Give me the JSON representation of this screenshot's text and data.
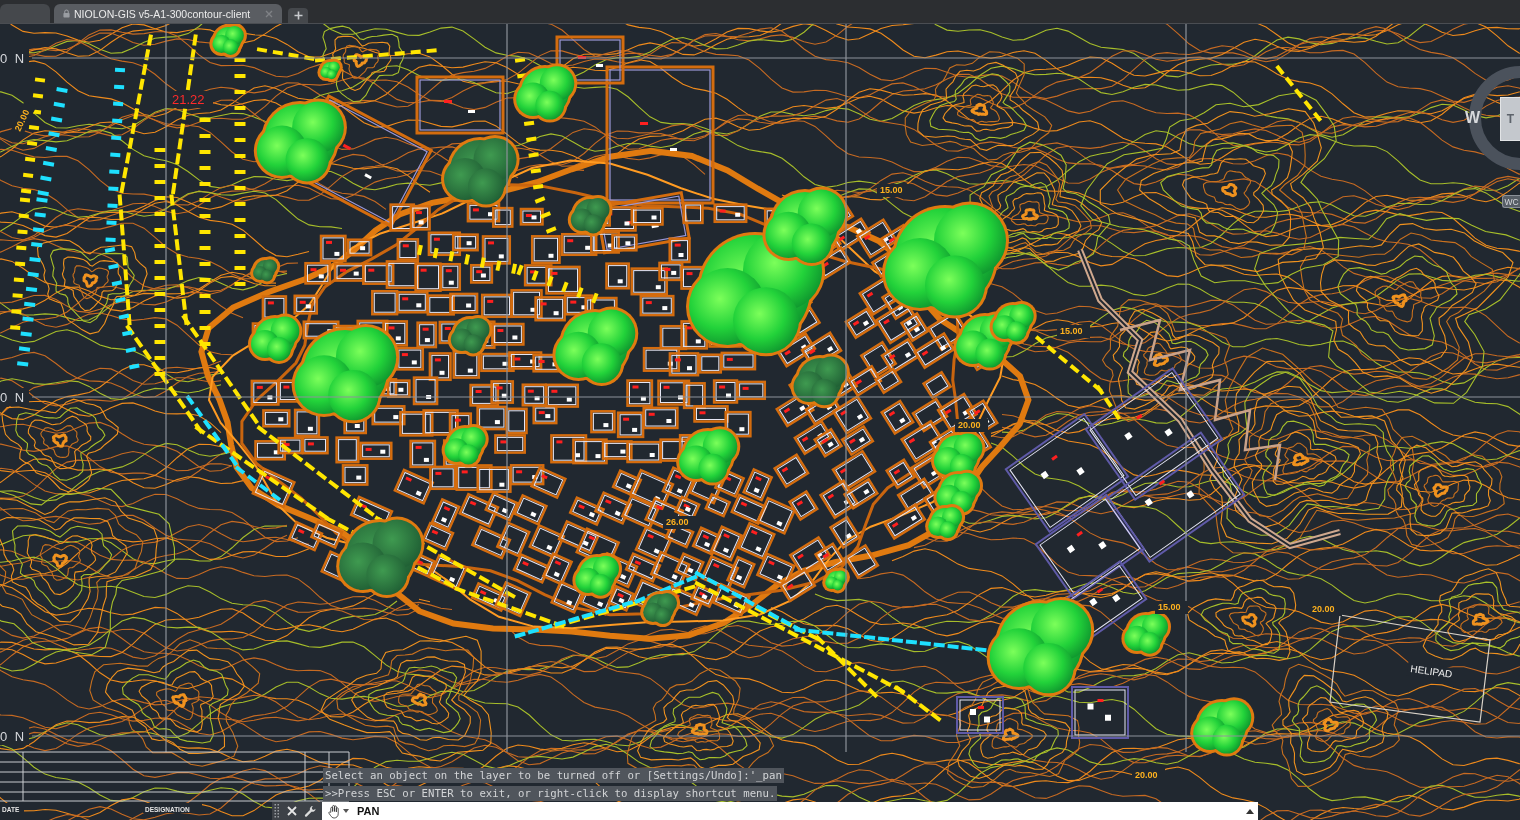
{
  "tabs": [
    {
      "kind": "start",
      "selected": false
    },
    {
      "kind": "drawing",
      "label": "NIOLON-GIS v5-A1-300contour-client",
      "locked": true,
      "selected": true
    }
  ],
  "drawing": {
    "grid_labels": [
      "0 N",
      "0 N",
      "0 N"
    ],
    "labels": [
      {
        "text": "21.22",
        "kind": "spot_height"
      },
      {
        "text": "HELIPAD",
        "kind": "area_name"
      },
      {
        "text": "20.00",
        "kind": "contour_height"
      },
      {
        "text": "26.00",
        "kind": "contour_height"
      },
      {
        "text": "15.00",
        "kind": "contour_height"
      },
      {
        "text": "20.00",
        "kind": "contour_height"
      },
      {
        "text": "20.00",
        "kind": "contour_height"
      },
      {
        "text": "15.00",
        "kind": "contour_height"
      },
      {
        "text": "15.00",
        "kind": "contour_height"
      },
      {
        "text": "20.00",
        "kind": "contour_height"
      }
    ],
    "title_block": {
      "headings": [
        "DATE",
        "DESIGNATION"
      ]
    }
  },
  "viewcube": {
    "compass": "W",
    "face": "T",
    "ucs": "WC"
  },
  "command_line": {
    "history": [
      "Select an object on the layer to be turned off or [Settings/Undo]:'_pan",
      ">>Press ESC or ENTER to exit, or right-click to display shortcut menu."
    ],
    "prompt": "PAN"
  }
}
